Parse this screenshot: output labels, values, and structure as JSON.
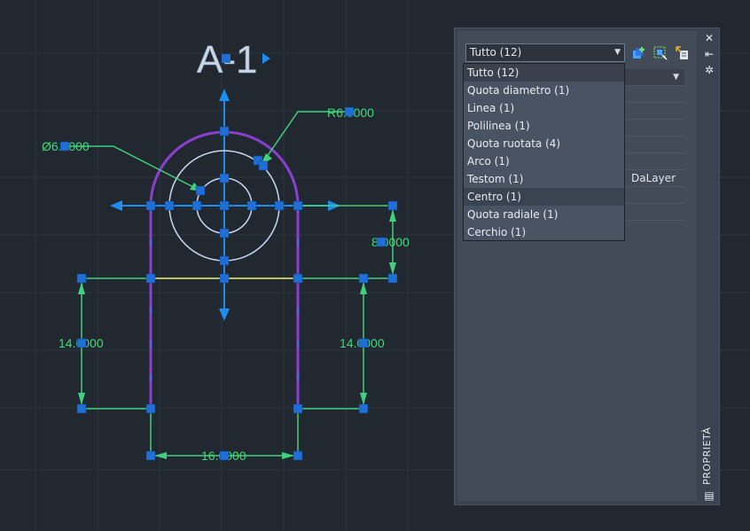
{
  "drawing": {
    "title": "A-1",
    "dimensions": {
      "diameter": "Ø6.0000",
      "radius": "R6.0000",
      "height_right": "8.0000",
      "left_side": "14.0000",
      "right_side": "14.0000",
      "bottom_width": "16.0000"
    }
  },
  "palette": {
    "selection": "Tutto (12)",
    "side_label": "PROPRIETÀ",
    "rows": [
      {
        "label": "",
        "value": ""
      },
      {
        "label": "",
        "value": ""
      },
      {
        "label": "",
        "value": ""
      },
      {
        "label": "",
        "value": ""
      },
      {
        "label": "",
        "value": ""
      },
      {
        "label": "",
        "value": ""
      },
      {
        "label": "",
        "value": "DaLayer"
      },
      {
        "label": "",
        "value": ""
      },
      {
        "label": "",
        "value": ""
      }
    ],
    "dropdown_items": [
      "Tutto (12)",
      "Quota diametro (1)",
      "Linea (1)",
      "Polilinea (1)",
      "Quota ruotata (4)",
      "Arco (1)",
      "Testom (1)",
      "Centro (1)",
      "Quota radiale (1)",
      "Cerchio (1)"
    ]
  },
  "colors": {
    "background": "#212830",
    "grip": "#1f6fd6",
    "dimension": "#3fdc7a",
    "polyline": "#8a3fd0",
    "circle": "#c8d8f0",
    "line": "#e8d66a"
  },
  "icons": [
    "quick-select-icon",
    "select-objects-icon",
    "pickadd-icon",
    "close-icon",
    "autohide-icon",
    "properties-menu-icon",
    "palette-icon"
  ]
}
